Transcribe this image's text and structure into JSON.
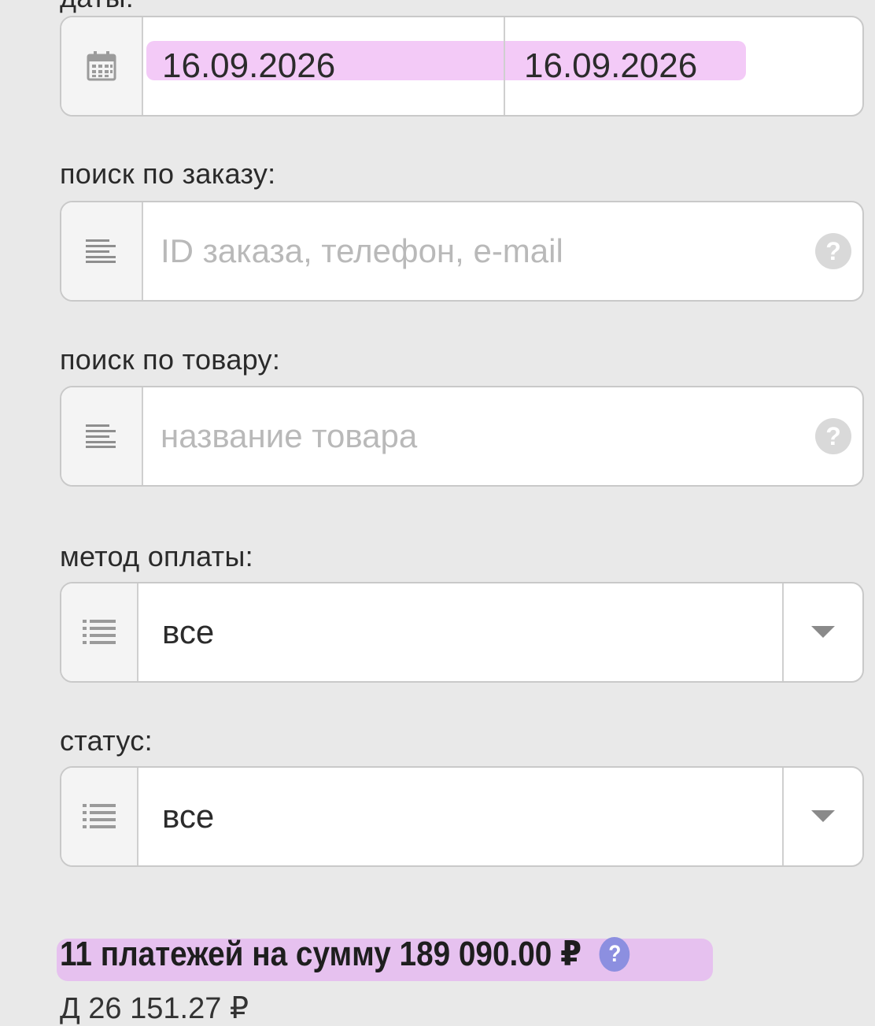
{
  "date_filter": {
    "label": "даты:",
    "from": "16.09.2026",
    "to": "16.09.2026",
    "icon": "calendar-icon"
  },
  "order_search": {
    "label": "поиск по заказу:",
    "placeholder": "ID заказа, телефон, e-mail",
    "icon": "text-lines-icon",
    "help": "?"
  },
  "product_search": {
    "label": "поиск по товару:",
    "placeholder": "название товара",
    "icon": "text-lines-icon",
    "help": "?"
  },
  "payment_method": {
    "label": "метод оплаты:",
    "value": "все",
    "icon": "list-icon"
  },
  "status": {
    "label": "статус:",
    "value": "все",
    "icon": "list-icon"
  },
  "summary": {
    "text": "11 платежей на сумму 189 090.00 ₽",
    "help": "?",
    "cutoff_line": "Д                                              26 151.27 ₽"
  },
  "colors": {
    "background": "#e9e9e9",
    "highlight": "#f2c6f6",
    "help_accent": "#8c8fe0"
  }
}
